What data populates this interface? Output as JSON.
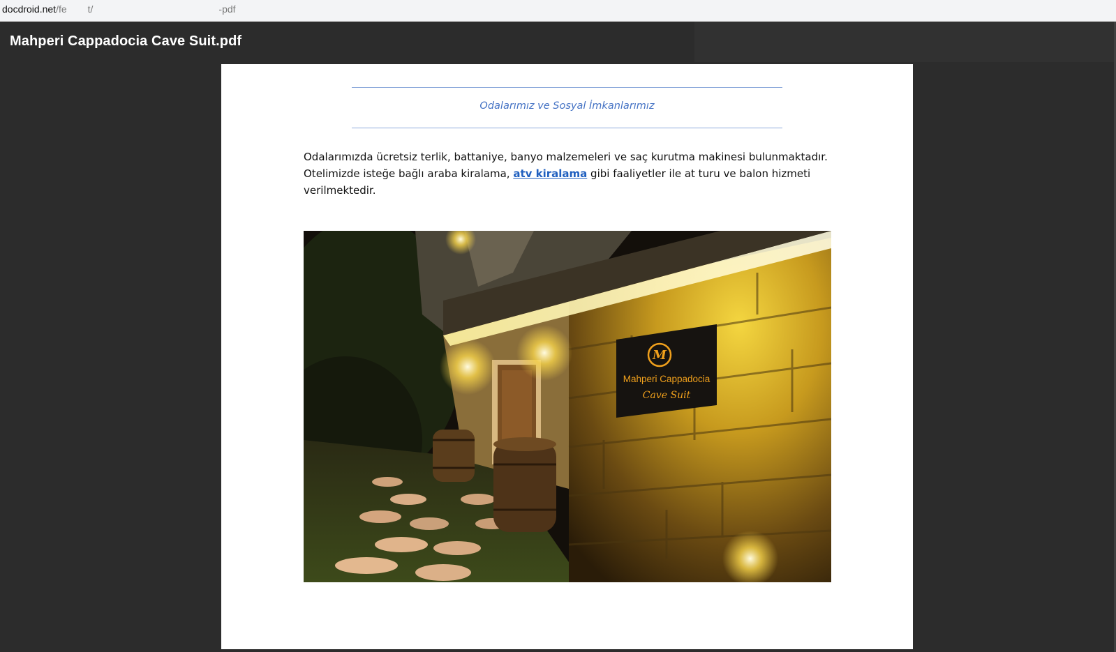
{
  "address_bar": {
    "host": "docdroid.net",
    "path_part1": "/fe",
    "path_part2": "t/",
    "path_part3": "-pdf"
  },
  "viewer": {
    "document_title": "Mahperi Cappadocia Cave Suit.pdf"
  },
  "page": {
    "heading": "Odalarımız ve Sosyal İmkanlarımız",
    "paragraph_before_link": "Odalarımızda ücretsiz terlik, battaniye, banyo malzemeleri ve saç kurutma makinesi bulunmaktadır. Otelimizde isteğe bağlı araba kiralama, ",
    "link_text": "atv kiralama",
    "paragraph_after_link": " gibi faaliyetler ile at turu ve balon hizmeti verilmektedir.",
    "photo": {
      "sign_line1": "Mahperi Cappadocia",
      "sign_line2": "Cave Suit",
      "sign_logo_letter": "M"
    }
  },
  "colors": {
    "heading": "#4472c4",
    "rule": "#8eaadb",
    "link": "#1f5fbf",
    "viewer_bg": "#2c2c2c"
  }
}
